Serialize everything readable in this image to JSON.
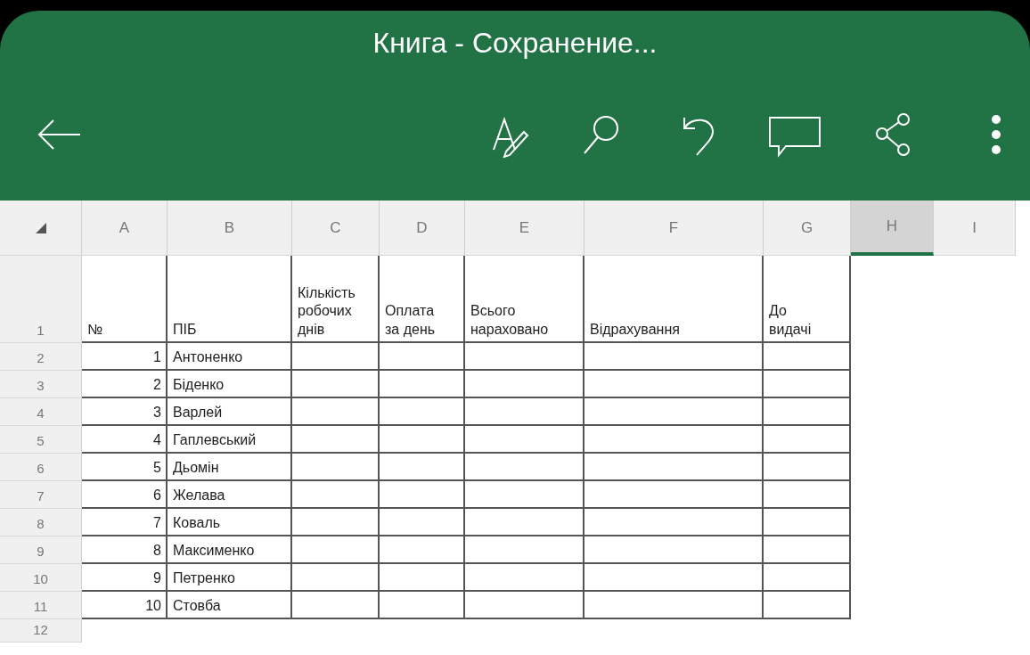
{
  "window": {
    "title": "Книга - Сохранение..."
  },
  "columns": [
    {
      "label": "A",
      "selected": false
    },
    {
      "label": "B",
      "selected": false
    },
    {
      "label": "C",
      "selected": false
    },
    {
      "label": "D",
      "selected": false
    },
    {
      "label": "E",
      "selected": false
    },
    {
      "label": "F",
      "selected": false
    },
    {
      "label": "G",
      "selected": false
    },
    {
      "label": "H",
      "selected": true
    },
    {
      "label": "I",
      "selected": false
    }
  ],
  "rows": [
    {
      "number": "1",
      "cells": [
        "№",
        "ПІБ",
        "Кількість\nробочих\nднів",
        "Оплата\nза день",
        "Всього\nнараховано",
        "Відрахування",
        "До\nвидачі"
      ]
    },
    {
      "number": "2",
      "cells": [
        "1",
        "Антоненко"
      ]
    },
    {
      "number": "3",
      "cells": [
        "2",
        "Біденко"
      ]
    },
    {
      "number": "4",
      "cells": [
        "3",
        "Варлей"
      ]
    },
    {
      "number": "5",
      "cells": [
        "4",
        "Гаплевський"
      ]
    },
    {
      "number": "6",
      "cells": [
        "5",
        "Дьомін"
      ]
    },
    {
      "number": "7",
      "cells": [
        "6",
        "Желава"
      ]
    },
    {
      "number": "8",
      "cells": [
        "7",
        "Коваль"
      ]
    },
    {
      "number": "9",
      "cells": [
        "8",
        "Максименко"
      ]
    },
    {
      "number": "10",
      "cells": [
        "9",
        "Петренко"
      ]
    },
    {
      "number": "11",
      "cells": [
        "10",
        "Стовба"
      ]
    },
    {
      "number": "12"
    }
  ]
}
